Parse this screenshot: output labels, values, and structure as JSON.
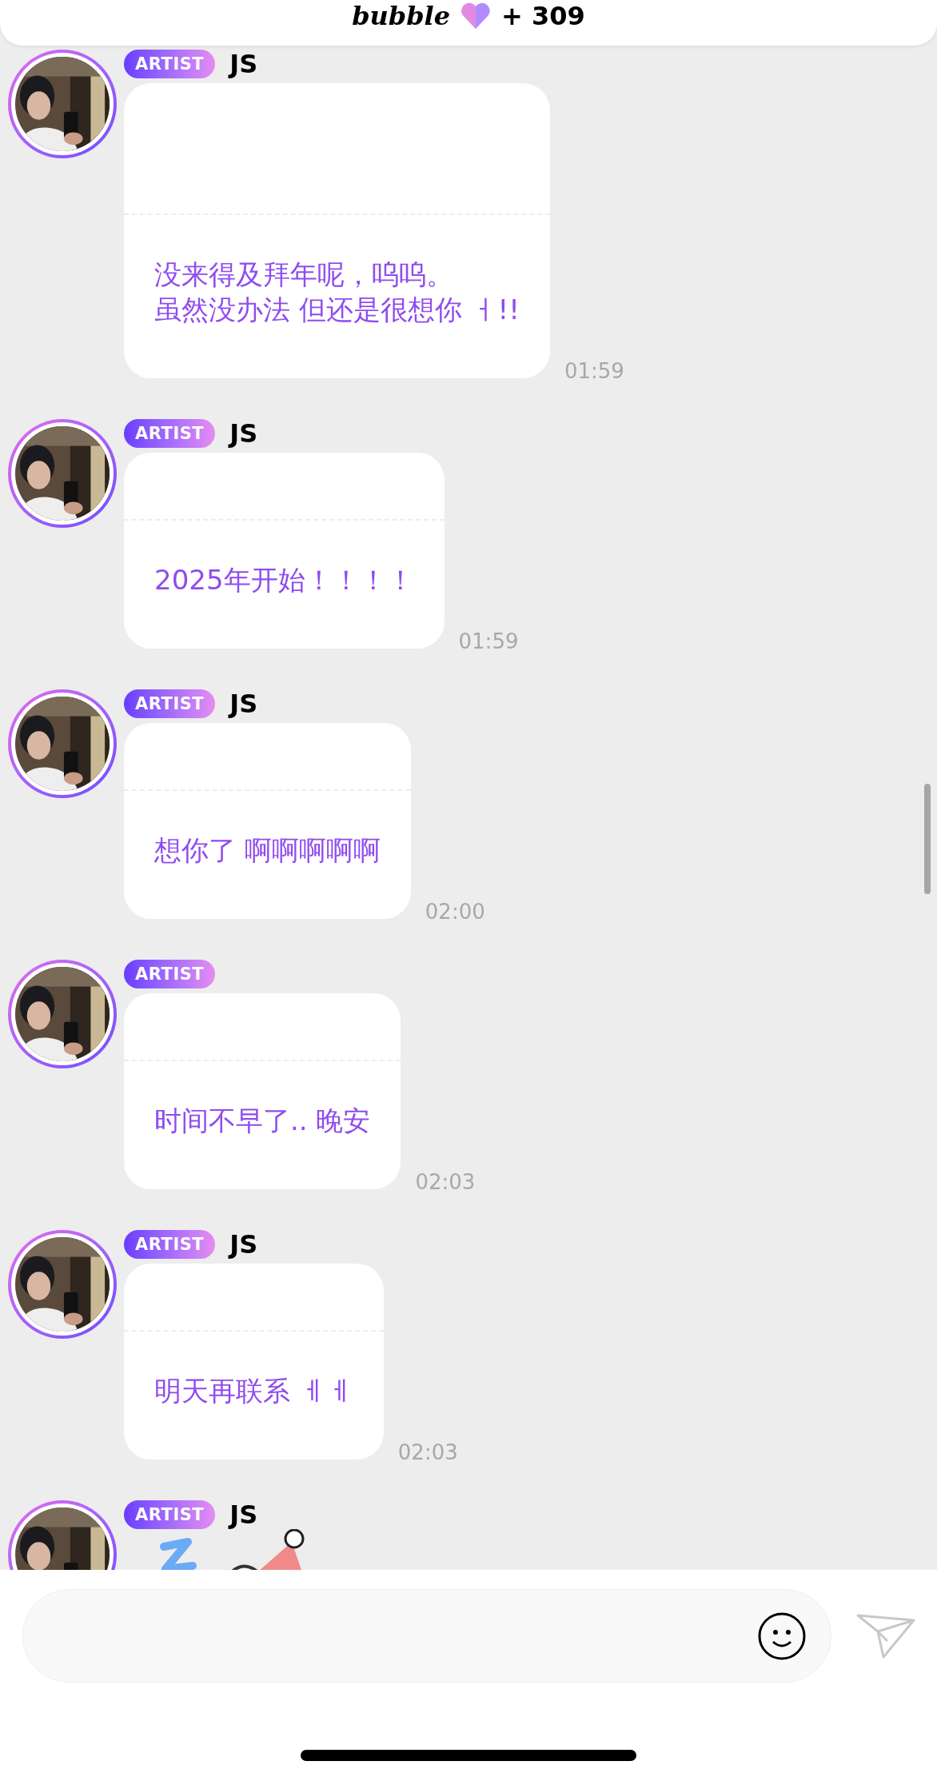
{
  "header": {
    "logo": "bubble",
    "count": "+ 309"
  },
  "messages": [
    {
      "badge": "ARTIST",
      "name": "JS",
      "lines": [
        "没来得及拜年呢，呜呜。",
        "虽然没办法 但还是很想你 ㅓ!!"
      ],
      "time": "01:59"
    },
    {
      "badge": "ARTIST",
      "name": "JS",
      "lines": [
        "2025年开始！！！！"
      ],
      "time": "01:59"
    },
    {
      "badge": "ARTIST",
      "name": "JS",
      "lines": [
        "想你了 啊啊啊啊啊"
      ],
      "time": "02:00"
    },
    {
      "badge": "ARTIST",
      "lines": [
        "时间不早了.. 晚安"
      ],
      "time": "02:03"
    },
    {
      "badge": "ARTIST",
      "name": "JS",
      "lines": [
        "明天再联系 ㅔㅔ"
      ],
      "time": "02:03"
    },
    {
      "badge": "ARTIST",
      "name": "JS",
      "kind": "sticker"
    }
  ]
}
